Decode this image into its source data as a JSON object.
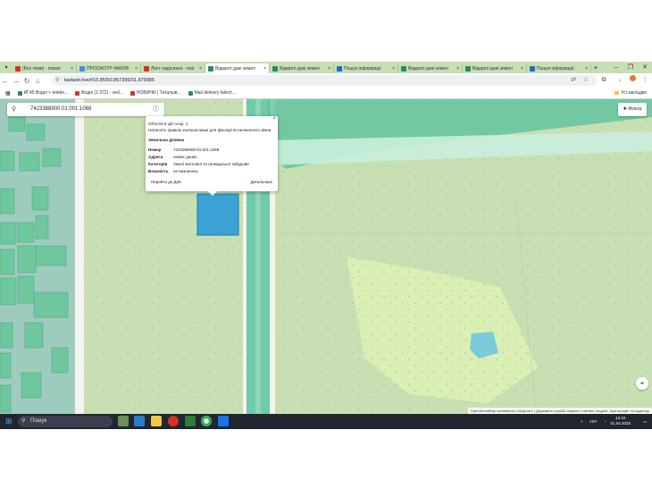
{
  "browser": {
    "tabs": [
      {
        "title": "(Без теми) - maran",
        "icon_color": "#d93025",
        "active": false
      },
      {
        "title": "ПРОСМОТР ФАЙЛА",
        "icon_color": "#4a8bd8",
        "active": false
      },
      {
        "title": "Лист надіслано - mai",
        "icon_color": "#d93025",
        "active": false
      },
      {
        "title": "Відкриті дані земел",
        "icon_color": "#2e8b57",
        "active": true
      },
      {
        "title": "Відкриті дані земел",
        "icon_color": "#2e8b57",
        "active": false
      },
      {
        "title": "Пошук інформації",
        "icon_color": "#1f6fbf",
        "active": false
      },
      {
        "title": "Відкриті дані земел",
        "icon_color": "#2e8b57",
        "active": false
      },
      {
        "title": "Відкриті дані земел",
        "icon_color": "#2e8b57",
        "active": false
      },
      {
        "title": "Пошук інформації",
        "icon_color": "#1f6fbf",
        "active": false
      }
    ],
    "new_tab_label": "+",
    "url": "kadastr.live/#16.85/50.857395/31.879985",
    "bookmarks": [
      {
        "label": "ИГ45 Водні + telebe..."
      },
      {
        "label": "Водні (1 372) - ved..."
      },
      {
        "label": "НОВИНИ | Татальів..."
      },
      {
        "label": "Mail delivery failed:..."
      }
    ],
    "all_bookmarks_label": "Усі закладки"
  },
  "map": {
    "search_value": "7423388900:01:001:1068",
    "filter_label": "Фільтр",
    "popup": {
      "line1": "Об'єктів в цій точці: 1",
      "line2": "Натисніть правою кнопкою миші для фіксації встановленого вікна",
      "section_title": "Земельна ділянка",
      "rows": [
        {
          "key": "Номер",
          "value": "7423388900:01:001:1068"
        },
        {
          "key": "Адреса",
          "value": "немає даних"
        },
        {
          "key": "Категорія",
          "value": "Землі житлової та громадської забудови"
        },
        {
          "key": "Власність",
          "value": "не визначено"
        }
      ],
      "link_dzk": "Перейти до ДЗК",
      "link_details": "Детальніше",
      "close": "×"
    },
    "attribution": "OpenStreetMap contributors | MapLibre | Державна служба України з питань геодезії, картографії та кадастру"
  },
  "taskbar": {
    "search_placeholder": "Пошук",
    "language": "УКР",
    "time": "12:22",
    "date": "01.04.2025"
  }
}
